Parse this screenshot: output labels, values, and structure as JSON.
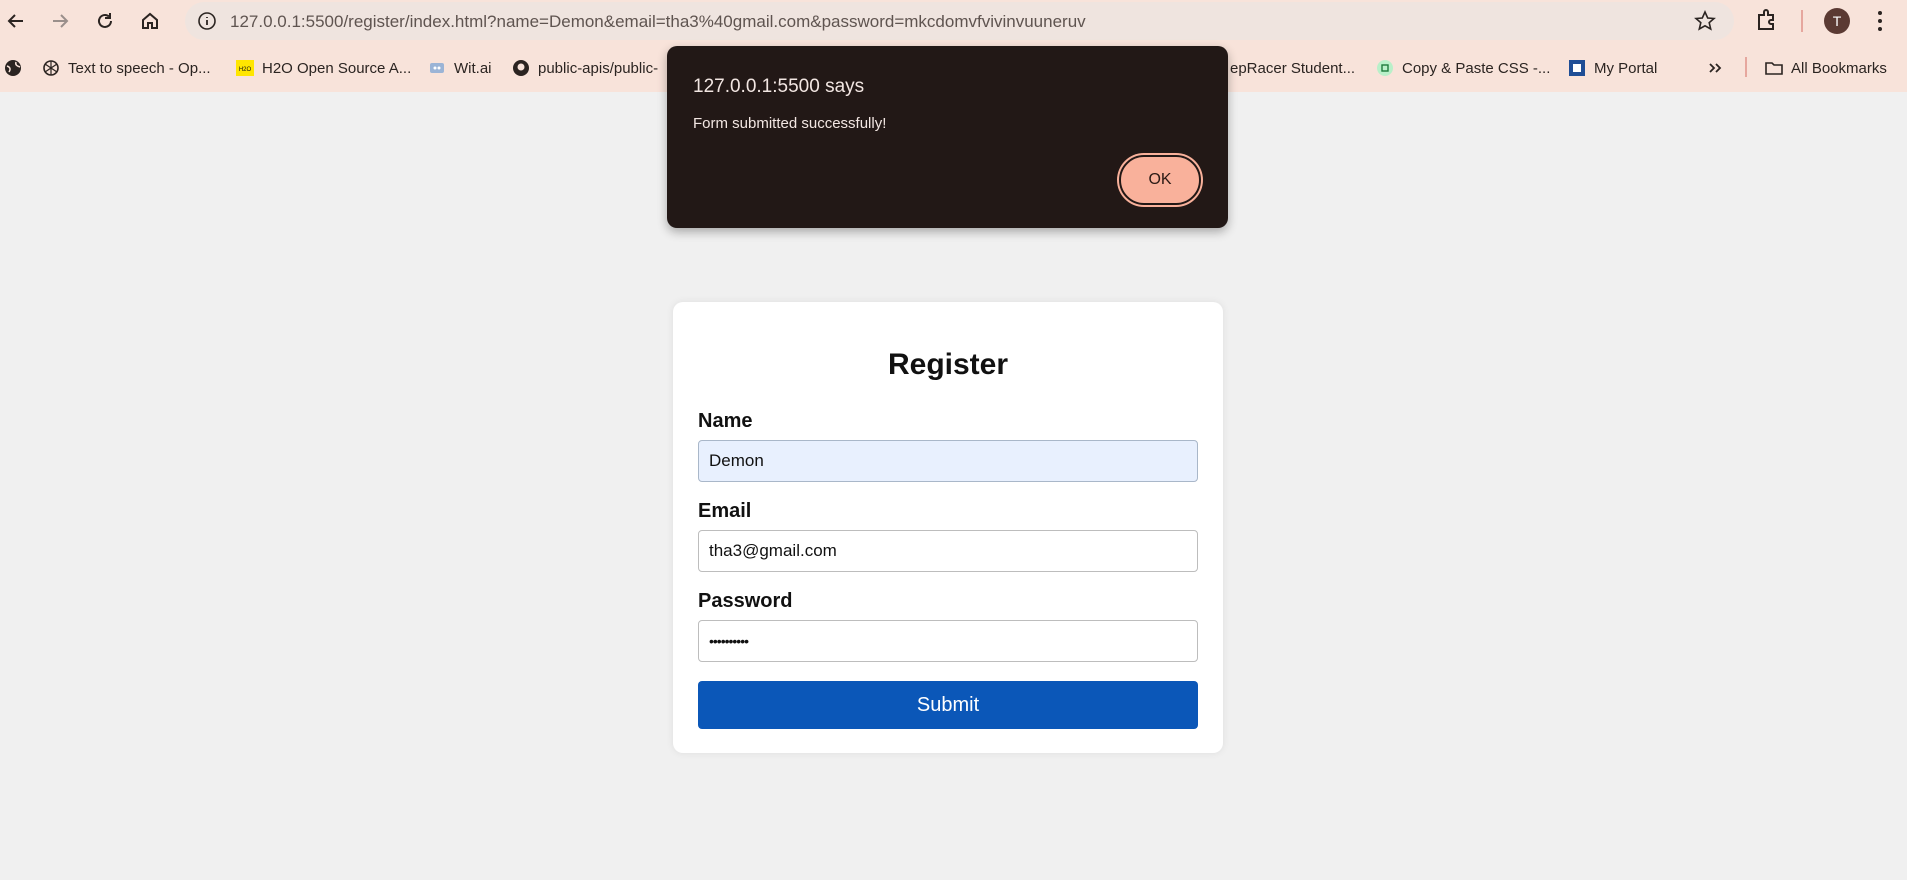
{
  "browser": {
    "url": "127.0.0.1:5500/register/index.html?name=Demon&email=tha3%40gmail.com&password=mkcdomvfvivinvuuneruv",
    "profile_initial": "T",
    "bookmarks": [
      {
        "label": "Text to speech - Op...",
        "icon": "openai-icon"
      },
      {
        "label": "H2O Open Source A...",
        "icon": "h2o-icon"
      },
      {
        "label": "Wit.ai",
        "icon": "wit-icon"
      },
      {
        "label": "public-apis/public-",
        "icon": "github-icon"
      },
      {
        "label": "epRacer Student...",
        "icon": "deepracer-icon"
      },
      {
        "label": "Copy & Paste CSS -...",
        "icon": "css-icon"
      },
      {
        "label": "My Portal",
        "icon": "portal-icon"
      }
    ],
    "all_bookmarks_label": "All Bookmarks"
  },
  "form": {
    "title": "Register",
    "name_label": "Name",
    "name_value": "Demon",
    "email_label": "Email",
    "email_value": "tha3@gmail.com",
    "password_label": "Password",
    "password_masked": "••••••••••",
    "submit_label": "Submit"
  },
  "dialog": {
    "title": "127.0.0.1:5500 says",
    "message": "Form submitted successfully!",
    "ok_label": "OK"
  },
  "colors": {
    "chrome": "#f8e3da",
    "submit": "#0b57b8",
    "dialog_bg": "#221816",
    "ok_button": "#f9b19b"
  }
}
